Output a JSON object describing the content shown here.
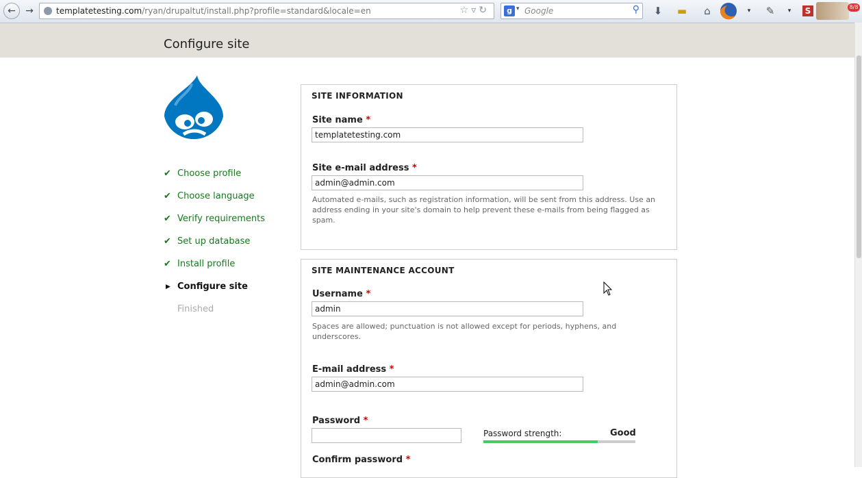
{
  "browser": {
    "url_host": "templatetesting.com",
    "url_path": "/ryan/drupaltut/install.php?profile=standard&locale=en",
    "search_placeholder": "Google",
    "search_engine_icon": "google-icon",
    "addon_badge": "8/8"
  },
  "header": {
    "title": "Configure site"
  },
  "sidebar": {
    "steps": [
      {
        "label": "Choose profile",
        "state": "done"
      },
      {
        "label": "Choose language",
        "state": "done"
      },
      {
        "label": "Verify requirements",
        "state": "done"
      },
      {
        "label": "Set up database",
        "state": "done"
      },
      {
        "label": "Install profile",
        "state": "done"
      },
      {
        "label": "Configure site",
        "state": "active"
      },
      {
        "label": "Finished",
        "state": "pending"
      }
    ],
    "check_glyph": "✔",
    "active_glyph": "▶"
  },
  "site_info": {
    "legend": "SITE INFORMATION",
    "site_name_label": "Site name",
    "site_name_value": "templatetesting.com",
    "email_label": "Site e-mail address",
    "email_value": "admin@admin.com",
    "email_description": "Automated e-mails, such as registration information, will be sent from this address. Use an address ending in your site's domain to help prevent these e-mails from being flagged as spam."
  },
  "account": {
    "legend": "SITE MAINTENANCE ACCOUNT",
    "username_label": "Username",
    "username_value": "admin",
    "username_description": "Spaces are allowed; punctuation is not allowed except for periods, hyphens, and underscores.",
    "email_label": "E-mail address",
    "email_value": "admin@admin.com",
    "password_label": "Password",
    "password_value": "",
    "strength_label": "Password strength:",
    "strength_value": "Good",
    "strength_fraction": 0.75,
    "confirm_label": "Confirm password"
  },
  "required_marker": "*",
  "colors": {
    "done": "#157a1a",
    "required": "#cc0000",
    "strength_good": "#47c965",
    "header_bg": "#e2e0d9",
    "drupal_blue": "#0077c0"
  }
}
